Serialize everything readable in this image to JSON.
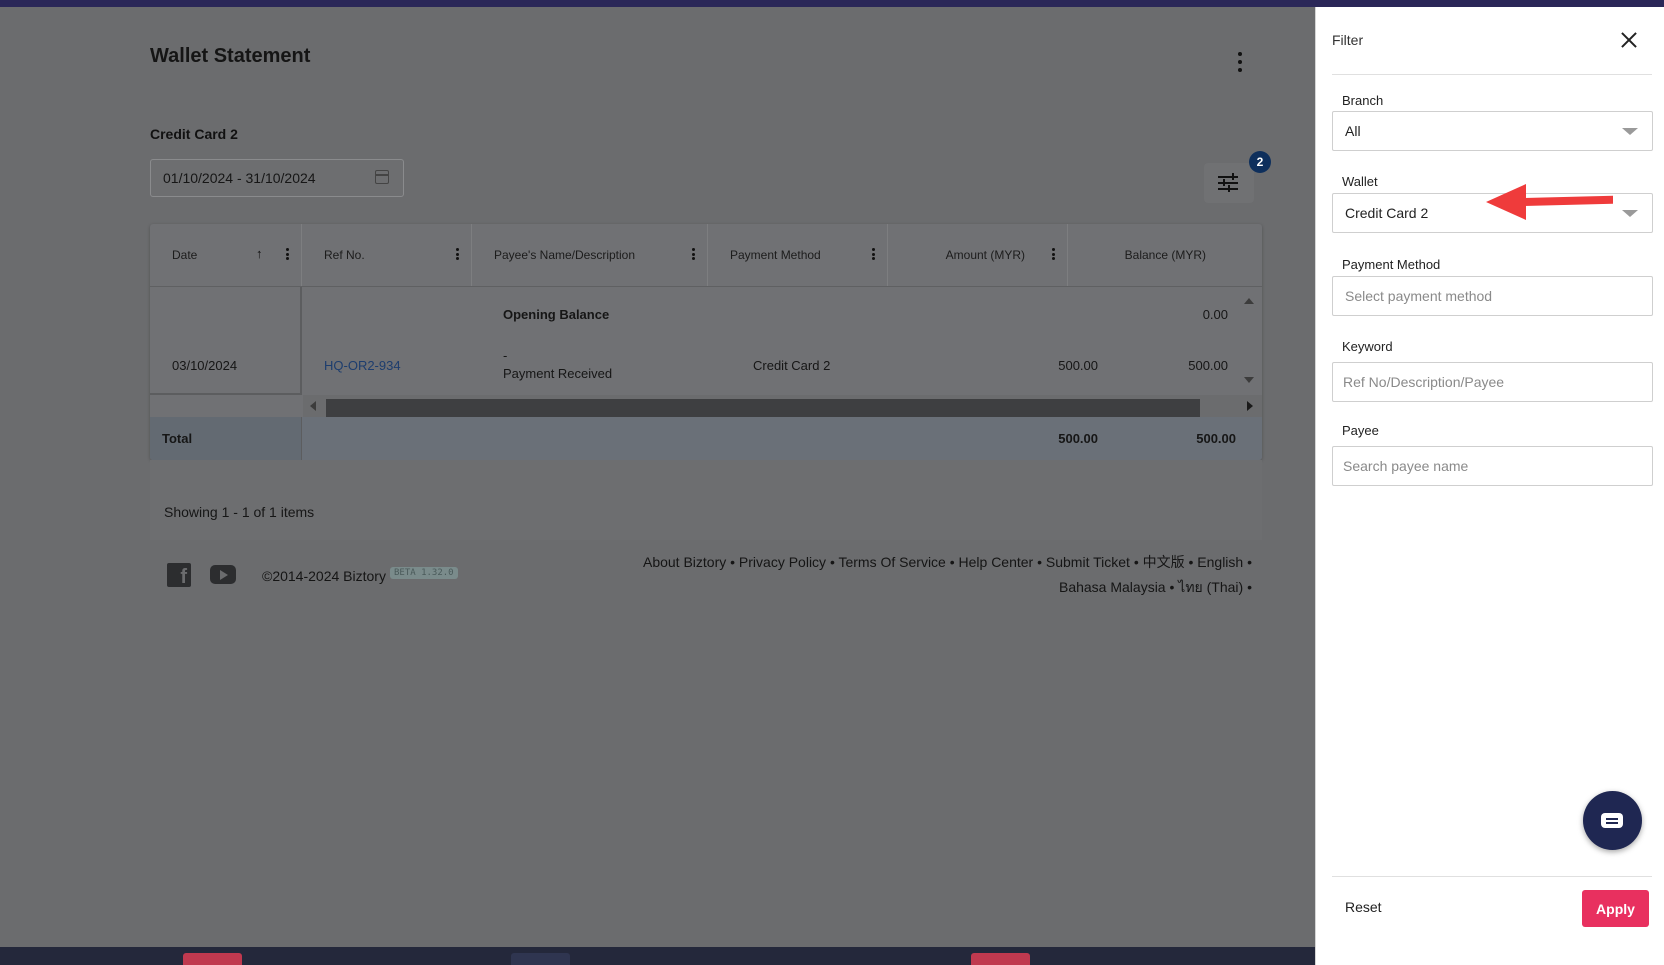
{
  "page": {
    "title": "Wallet Statement",
    "wallet_name": "Credit Card 2",
    "date_range": "01/10/2024 - 31/10/2024",
    "filter_count": "2"
  },
  "colors": {
    "topbar": "#2a2758",
    "apply": "#e8305f",
    "badge": "#0e2f5c",
    "annotation_arrow": "#ef3b3b"
  },
  "table": {
    "columns": [
      "Date",
      "Ref No.",
      "Payee's Name/Description",
      "Payment Method",
      "Amount (MYR)",
      "Balance (MYR)"
    ],
    "opening": {
      "label": "Opening Balance",
      "balance": "0.00"
    },
    "rows": [
      {
        "date": "03/10/2024",
        "ref": "HQ-OR2-934",
        "payee": "-",
        "description": "Payment Received",
        "method": "Credit Card 2",
        "amount": "500.00",
        "balance": "500.00"
      }
    ],
    "total": {
      "label": "Total",
      "amount": "500.00",
      "balance": "500.00"
    },
    "showing": "Showing 1 - 1 of 1 items"
  },
  "footer": {
    "copyright": "©2014-2024 Biztory",
    "beta": "BETA 1.32.0",
    "links_line1": "About Biztory • Privacy Policy • Terms Of Service • Help Center • Submit Ticket • 中文版 • English •",
    "links_line2": "Bahasa Malaysia • ไทย (Thai) •"
  },
  "filter": {
    "title": "Filter",
    "branch_label": "Branch",
    "branch_value": "All",
    "wallet_label": "Wallet",
    "wallet_value": "Credit Card 2",
    "payment_method_label": "Payment Method",
    "payment_method_placeholder": "Select payment method",
    "keyword_label": "Keyword",
    "keyword_placeholder": "Ref No/Description/Payee",
    "payee_label": "Payee",
    "payee_placeholder": "Search payee name",
    "reset": "Reset",
    "apply": "Apply"
  }
}
